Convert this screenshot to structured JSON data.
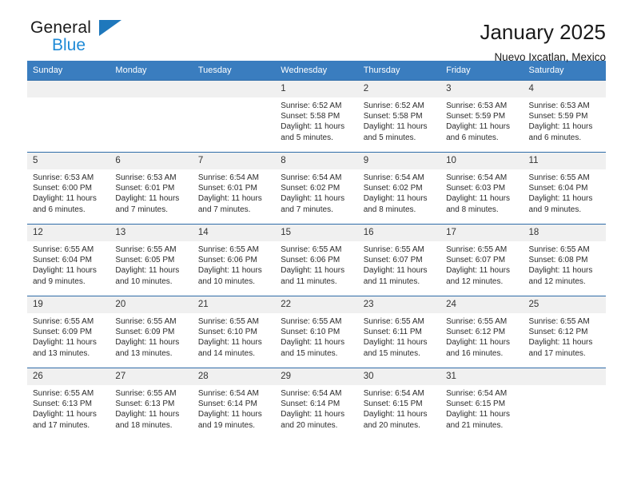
{
  "brand": {
    "name_top": "General",
    "name_bottom": "Blue",
    "triangle_color": "#1f78bc",
    "blue_text_color": "#1f8ad6"
  },
  "header": {
    "title": "January 2025",
    "subtitle": "Nuevo Ixcatlan, Mexico"
  },
  "theme": {
    "header_row_bg": "#3a7dbf",
    "row_separator": "#2f6ca8",
    "daynum_bg": "#f0f0f0"
  },
  "calendar": {
    "weekdays": [
      "Sunday",
      "Monday",
      "Tuesday",
      "Wednesday",
      "Thursday",
      "Friday",
      "Saturday"
    ],
    "labels": {
      "sunrise": "Sunrise:",
      "sunset": "Sunset:",
      "daylight": "Daylight:"
    },
    "weeks": [
      [
        {
          "day": "",
          "empty": true
        },
        {
          "day": "",
          "empty": true
        },
        {
          "day": "",
          "empty": true
        },
        {
          "day": "1",
          "sunrise": "Sunrise: 6:52 AM",
          "sunset": "Sunset: 5:58 PM",
          "daylight": "Daylight: 11 hours and 5 minutes."
        },
        {
          "day": "2",
          "sunrise": "Sunrise: 6:52 AM",
          "sunset": "Sunset: 5:58 PM",
          "daylight": "Daylight: 11 hours and 5 minutes."
        },
        {
          "day": "3",
          "sunrise": "Sunrise: 6:53 AM",
          "sunset": "Sunset: 5:59 PM",
          "daylight": "Daylight: 11 hours and 6 minutes."
        },
        {
          "day": "4",
          "sunrise": "Sunrise: 6:53 AM",
          "sunset": "Sunset: 5:59 PM",
          "daylight": "Daylight: 11 hours and 6 minutes."
        }
      ],
      [
        {
          "day": "5",
          "sunrise": "Sunrise: 6:53 AM",
          "sunset": "Sunset: 6:00 PM",
          "daylight": "Daylight: 11 hours and 6 minutes."
        },
        {
          "day": "6",
          "sunrise": "Sunrise: 6:53 AM",
          "sunset": "Sunset: 6:01 PM",
          "daylight": "Daylight: 11 hours and 7 minutes."
        },
        {
          "day": "7",
          "sunrise": "Sunrise: 6:54 AM",
          "sunset": "Sunset: 6:01 PM",
          "daylight": "Daylight: 11 hours and 7 minutes."
        },
        {
          "day": "8",
          "sunrise": "Sunrise: 6:54 AM",
          "sunset": "Sunset: 6:02 PM",
          "daylight": "Daylight: 11 hours and 7 minutes."
        },
        {
          "day": "9",
          "sunrise": "Sunrise: 6:54 AM",
          "sunset": "Sunset: 6:02 PM",
          "daylight": "Daylight: 11 hours and 8 minutes."
        },
        {
          "day": "10",
          "sunrise": "Sunrise: 6:54 AM",
          "sunset": "Sunset: 6:03 PM",
          "daylight": "Daylight: 11 hours and 8 minutes."
        },
        {
          "day": "11",
          "sunrise": "Sunrise: 6:55 AM",
          "sunset": "Sunset: 6:04 PM",
          "daylight": "Daylight: 11 hours and 9 minutes."
        }
      ],
      [
        {
          "day": "12",
          "sunrise": "Sunrise: 6:55 AM",
          "sunset": "Sunset: 6:04 PM",
          "daylight": "Daylight: 11 hours and 9 minutes."
        },
        {
          "day": "13",
          "sunrise": "Sunrise: 6:55 AM",
          "sunset": "Sunset: 6:05 PM",
          "daylight": "Daylight: 11 hours and 10 minutes."
        },
        {
          "day": "14",
          "sunrise": "Sunrise: 6:55 AM",
          "sunset": "Sunset: 6:06 PM",
          "daylight": "Daylight: 11 hours and 10 minutes."
        },
        {
          "day": "15",
          "sunrise": "Sunrise: 6:55 AM",
          "sunset": "Sunset: 6:06 PM",
          "daylight": "Daylight: 11 hours and 11 minutes."
        },
        {
          "day": "16",
          "sunrise": "Sunrise: 6:55 AM",
          "sunset": "Sunset: 6:07 PM",
          "daylight": "Daylight: 11 hours and 11 minutes."
        },
        {
          "day": "17",
          "sunrise": "Sunrise: 6:55 AM",
          "sunset": "Sunset: 6:07 PM",
          "daylight": "Daylight: 11 hours and 12 minutes."
        },
        {
          "day": "18",
          "sunrise": "Sunrise: 6:55 AM",
          "sunset": "Sunset: 6:08 PM",
          "daylight": "Daylight: 11 hours and 12 minutes."
        }
      ],
      [
        {
          "day": "19",
          "sunrise": "Sunrise: 6:55 AM",
          "sunset": "Sunset: 6:09 PM",
          "daylight": "Daylight: 11 hours and 13 minutes."
        },
        {
          "day": "20",
          "sunrise": "Sunrise: 6:55 AM",
          "sunset": "Sunset: 6:09 PM",
          "daylight": "Daylight: 11 hours and 13 minutes."
        },
        {
          "day": "21",
          "sunrise": "Sunrise: 6:55 AM",
          "sunset": "Sunset: 6:10 PM",
          "daylight": "Daylight: 11 hours and 14 minutes."
        },
        {
          "day": "22",
          "sunrise": "Sunrise: 6:55 AM",
          "sunset": "Sunset: 6:10 PM",
          "daylight": "Daylight: 11 hours and 15 minutes."
        },
        {
          "day": "23",
          "sunrise": "Sunrise: 6:55 AM",
          "sunset": "Sunset: 6:11 PM",
          "daylight": "Daylight: 11 hours and 15 minutes."
        },
        {
          "day": "24",
          "sunrise": "Sunrise: 6:55 AM",
          "sunset": "Sunset: 6:12 PM",
          "daylight": "Daylight: 11 hours and 16 minutes."
        },
        {
          "day": "25",
          "sunrise": "Sunrise: 6:55 AM",
          "sunset": "Sunset: 6:12 PM",
          "daylight": "Daylight: 11 hours and 17 minutes."
        }
      ],
      [
        {
          "day": "26",
          "sunrise": "Sunrise: 6:55 AM",
          "sunset": "Sunset: 6:13 PM",
          "daylight": "Daylight: 11 hours and 17 minutes."
        },
        {
          "day": "27",
          "sunrise": "Sunrise: 6:55 AM",
          "sunset": "Sunset: 6:13 PM",
          "daylight": "Daylight: 11 hours and 18 minutes."
        },
        {
          "day": "28",
          "sunrise": "Sunrise: 6:54 AM",
          "sunset": "Sunset: 6:14 PM",
          "daylight": "Daylight: 11 hours and 19 minutes."
        },
        {
          "day": "29",
          "sunrise": "Sunrise: 6:54 AM",
          "sunset": "Sunset: 6:14 PM",
          "daylight": "Daylight: 11 hours and 20 minutes."
        },
        {
          "day": "30",
          "sunrise": "Sunrise: 6:54 AM",
          "sunset": "Sunset: 6:15 PM",
          "daylight": "Daylight: 11 hours and 20 minutes."
        },
        {
          "day": "31",
          "sunrise": "Sunrise: 6:54 AM",
          "sunset": "Sunset: 6:15 PM",
          "daylight": "Daylight: 11 hours and 21 minutes."
        },
        {
          "day": "",
          "empty": true
        }
      ]
    ]
  }
}
